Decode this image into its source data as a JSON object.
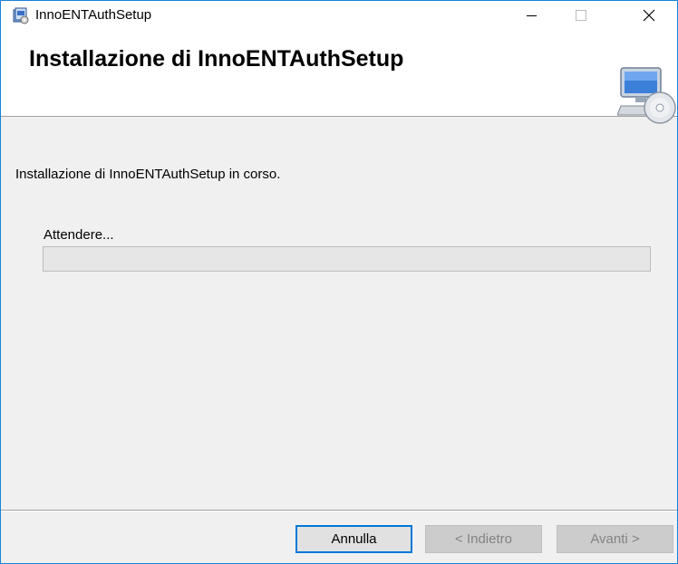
{
  "window": {
    "title": "InnoENTAuthSetup",
    "accent_color": "#1883d7",
    "app_icon": "installer-package-icon",
    "controls": {
      "minimize_label": "minimize",
      "maximize_label": "maximize",
      "close_label": "close"
    }
  },
  "header": {
    "title": "Installazione di InnoENTAuthSetup",
    "icon": "computer-cd-icon"
  },
  "body": {
    "status_text": "Installazione di InnoENTAuthSetup in corso.",
    "progress_label": "Attendere...",
    "progress_fraction": 0
  },
  "buttons": {
    "cancel": "Annulla",
    "back": "< Indietro",
    "next": "Avanti >"
  }
}
